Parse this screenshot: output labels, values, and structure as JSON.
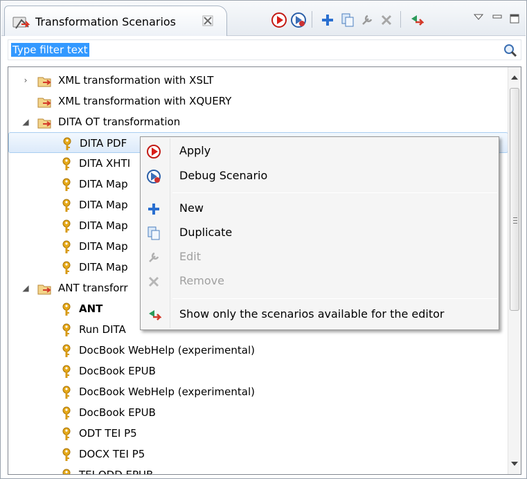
{
  "view": {
    "title": "Transformation Scenarios",
    "toolbar": [
      "apply-icon",
      "debug-scenario-icon",
      "new-icon",
      "duplicate-icon",
      "edit-icon",
      "remove-icon",
      "show-only-available-icon",
      "view-menu-icon",
      "minimize-icon",
      "maximize-icon"
    ]
  },
  "filter": {
    "text": "Type filter text"
  },
  "tree": {
    "rows": [
      {
        "label": "XML transformation with XSLT",
        "expander": "›"
      },
      {
        "label": "XML transformation with XQUERY",
        "expander": ""
      },
      {
        "label": "DITA OT transformation",
        "expander": "◢"
      },
      {
        "label": "DITA PDF"
      },
      {
        "label": "DITA XHTI"
      },
      {
        "label": "DITA Map"
      },
      {
        "label": "DITA Map"
      },
      {
        "label": "DITA Map"
      },
      {
        "label": "DITA Map"
      },
      {
        "label": "DITA Map"
      },
      {
        "label": "ANT transforr",
        "expander": "◢"
      },
      {
        "label": "ANT"
      },
      {
        "label": "Run DITA"
      },
      {
        "label": "DocBook WebHelp (experimental)"
      },
      {
        "label": "DocBook EPUB"
      },
      {
        "label": "DocBook WebHelp (experimental)"
      },
      {
        "label": "DocBook EPUB"
      },
      {
        "label": "ODT TEI P5"
      },
      {
        "label": "DOCX TEI P5"
      },
      {
        "label": "TEI ODD EPUB"
      }
    ]
  },
  "context_menu": {
    "items": [
      {
        "label": "Apply",
        "icon": "apply-icon",
        "enabled": true
      },
      {
        "label": "Debug Scenario",
        "icon": "debug-scenario-icon",
        "enabled": true
      },
      {
        "label": "New",
        "icon": "new-icon",
        "enabled": true
      },
      {
        "label": "Duplicate",
        "icon": "duplicate-icon",
        "enabled": true
      },
      {
        "label": "Edit",
        "icon": "edit-icon",
        "enabled": false
      },
      {
        "label": "Remove",
        "icon": "remove-icon",
        "enabled": false
      },
      {
        "label": "Show only the scenarios available for the editor",
        "icon": "show-only-available-icon",
        "enabled": true
      }
    ]
  },
  "colors": {
    "selection": "#3399ff",
    "scenario_key": "#d79a14",
    "apply_red": "#d91e18",
    "add_blue": "#2a6fd0"
  }
}
